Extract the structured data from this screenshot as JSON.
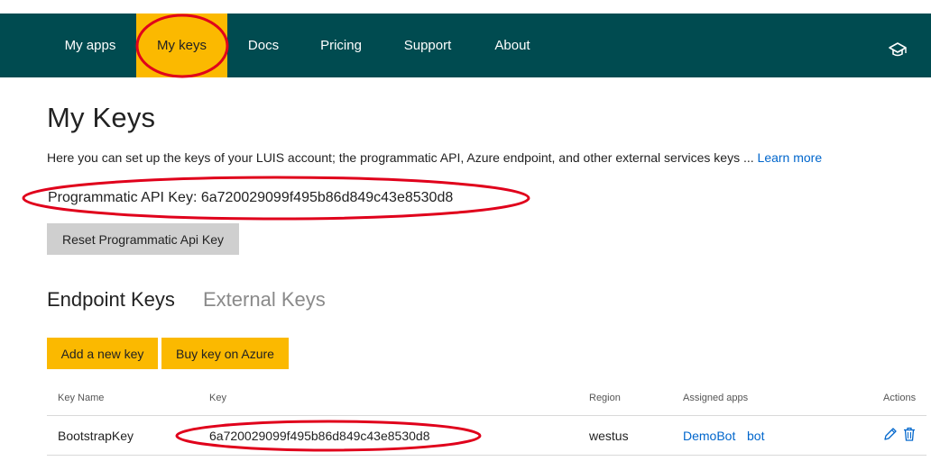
{
  "nav": {
    "items": [
      {
        "label": "My apps"
      },
      {
        "label": "My keys"
      },
      {
        "label": "Docs"
      },
      {
        "label": "Pricing"
      },
      {
        "label": "Support"
      },
      {
        "label": "About"
      }
    ],
    "icon": "graduation-cap-icon"
  },
  "page": {
    "title": "My Keys",
    "description": "Here you can set up the keys of your LUIS account; the programmatic API, Azure endpoint, and other external services keys ... ",
    "learn_more": "Learn more",
    "api_key_label": "Programmatic API Key: ",
    "api_key_value": "6a720029099f495b86d849c43e8530d8",
    "reset_button": "Reset Programmatic Api Key"
  },
  "tabs": [
    {
      "label": "Endpoint Keys",
      "active": true
    },
    {
      "label": "External Keys",
      "active": false
    }
  ],
  "actions": {
    "add_key": "Add a new key",
    "buy_key": "Buy key on Azure"
  },
  "table": {
    "headers": {
      "key_name": "Key Name",
      "key": "Key",
      "region": "Region",
      "assigned_apps": "Assigned apps",
      "actions": "Actions"
    },
    "rows": [
      {
        "key_name": "BootstrapKey",
        "key": "6a720029099f495b86d849c43e8530d8",
        "region": "westus",
        "apps": [
          "DemoBot",
          "bot"
        ],
        "action_icons": [
          "pencil-icon",
          "trash-icon"
        ]
      }
    ]
  },
  "colors": {
    "navbar": "#004b50",
    "accent": "#fbb900",
    "link": "#0066cc",
    "annotation": "#e0001b"
  }
}
